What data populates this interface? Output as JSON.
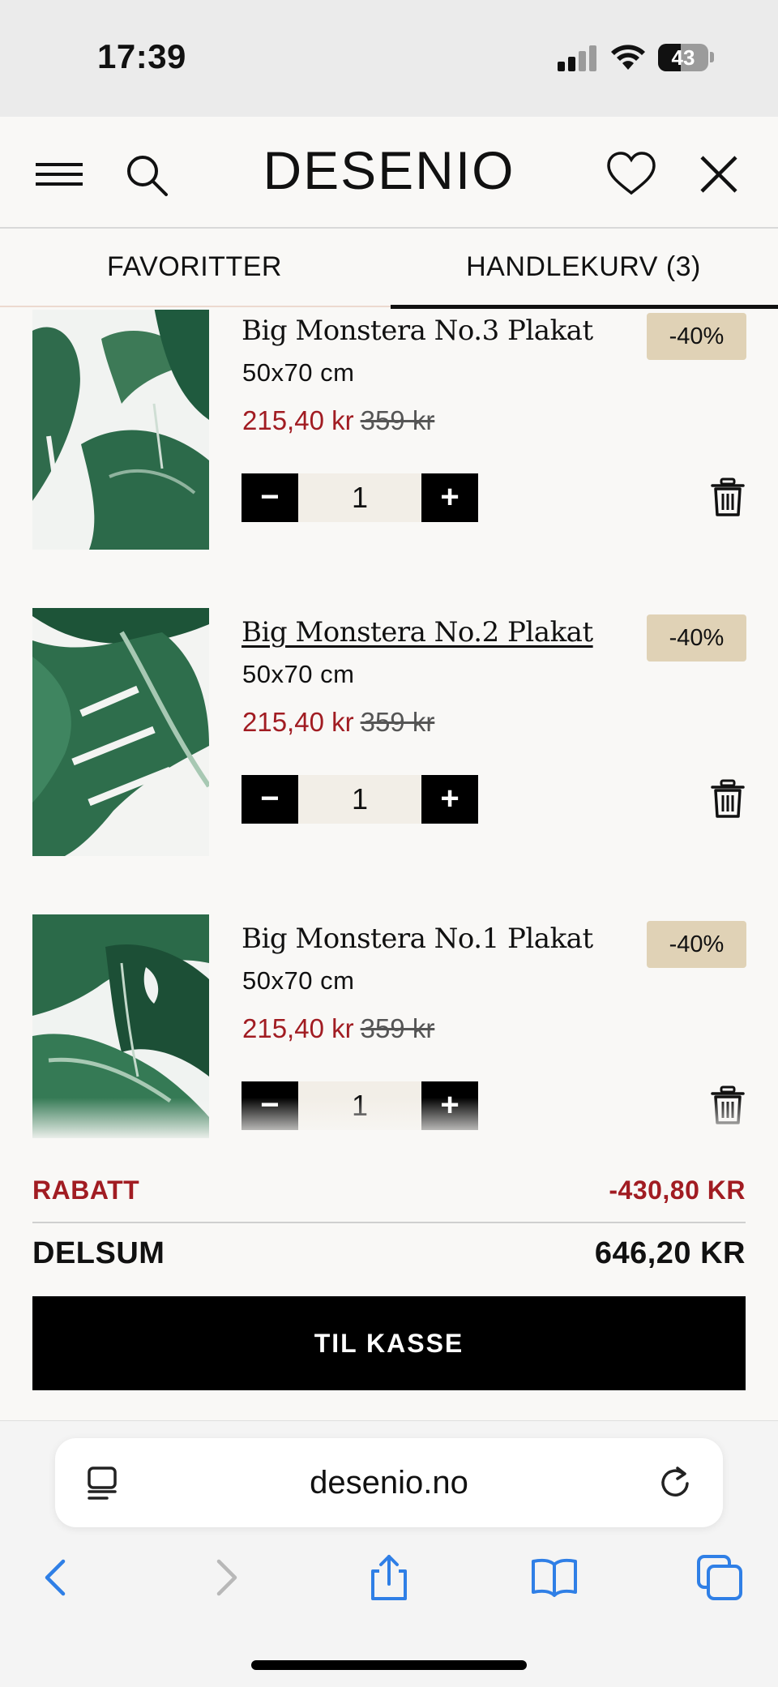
{
  "status_bar": {
    "time": "17:39",
    "battery": "43"
  },
  "header": {
    "logo": "DESENIO"
  },
  "tabs": [
    {
      "label": "FAVORITTER",
      "active": false
    },
    {
      "label": "HANDLEKURV (3)",
      "active": true
    }
  ],
  "cart": {
    "items": [
      {
        "name": "Big Monstera No.3 Plakat",
        "size": "50x70 cm",
        "sale_price": "215,40 kr",
        "original_price": "359 kr",
        "discount": "-40%",
        "quantity": "1"
      },
      {
        "name": "Big Monstera No.2 Plakat",
        "size": "50x70 cm",
        "sale_price": "215,40 kr",
        "original_price": "359 kr",
        "discount": "-40%",
        "quantity": "1"
      },
      {
        "name": "Big Monstera No.1 Plakat",
        "size": "50x70 cm",
        "sale_price": "215,40 kr",
        "original_price": "359 kr",
        "discount": "-40%",
        "quantity": "1"
      }
    ],
    "stepper": {
      "minus": "−",
      "plus": "+"
    }
  },
  "totals": {
    "discount_label": "RABATT",
    "discount_value": "-430,80 KR",
    "subtotal_label": "DELSUM",
    "subtotal_value": "646,20 KR"
  },
  "checkout_label": "TIL KASSE",
  "browser": {
    "url": "desenio.no"
  },
  "colors": {
    "sale_red": "#a11c22",
    "badge_bg": "#e0d2b6",
    "button_black": "#000000",
    "safari_blue": "#2f7fe6"
  },
  "icons": [
    "menu-icon",
    "search-icon",
    "heart-icon",
    "close-icon",
    "trash-icon",
    "reader-icon",
    "reload-icon",
    "back-icon",
    "forward-icon",
    "share-icon",
    "bookmarks-icon",
    "tabs-icon"
  ]
}
